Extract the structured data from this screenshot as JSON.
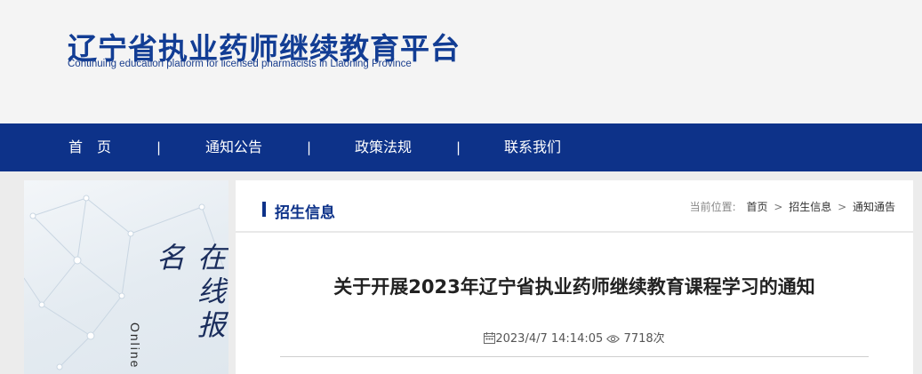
{
  "header": {
    "title_cn": "辽宁省执业药师继续教育平台",
    "title_en": "Continuing education platform for licensed pharmacists in Liaoning Province"
  },
  "nav": {
    "items": [
      {
        "label": "首　页"
      },
      {
        "label": "通知公告"
      },
      {
        "label": "政策法规"
      },
      {
        "label": "联系我们"
      }
    ],
    "separator": "|"
  },
  "banner": {
    "vertical_cn": "在线报名",
    "vertical_en": "Online"
  },
  "section": {
    "title": "招生信息"
  },
  "breadcrumb": {
    "label": "当前位置:",
    "items": [
      "首页",
      "招生信息",
      "通知通告"
    ],
    "separator": ">"
  },
  "article": {
    "title": "关于开展2023年辽宁省执业药师继续教育课程学习的通知",
    "datetime": "2023/4/7 14:14:05",
    "views": "7718次"
  },
  "icons": {
    "calendar": "calendar-icon",
    "eye": "eye-icon"
  },
  "colors": {
    "brand_blue": "#0d3289",
    "logo_blue": "#123d94",
    "header_bg": "#f4f4f4",
    "page_bg": "#ececec"
  }
}
